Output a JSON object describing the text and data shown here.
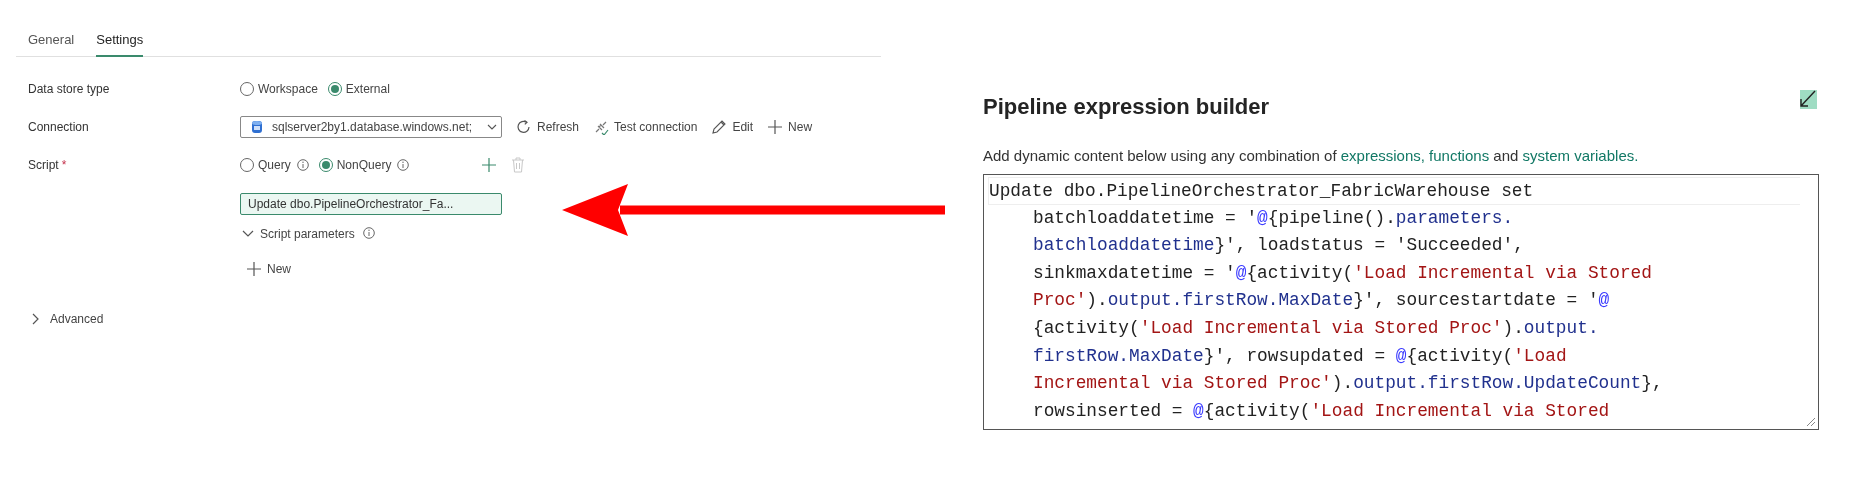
{
  "tabs": [
    {
      "label": "General",
      "selected": false
    },
    {
      "label": "Settings",
      "selected": true
    }
  ],
  "form": {
    "data_store_type": {
      "label": "Data store type",
      "options": [
        {
          "label": "Workspace",
          "selected": false
        },
        {
          "label": "External",
          "selected": true
        }
      ]
    },
    "connection": {
      "label": "Connection",
      "value": "sqlserver2by1.database.windows.net;",
      "actions": [
        {
          "label": "Refresh",
          "kind": "refresh"
        },
        {
          "label": "Test connection",
          "kind": "test"
        },
        {
          "label": "Edit",
          "kind": "edit"
        },
        {
          "label": "New",
          "kind": "new"
        }
      ]
    },
    "script": {
      "label": "Script",
      "required_mark": "*",
      "options": [
        {
          "label": "Query",
          "selected": false
        },
        {
          "label": "NonQuery",
          "selected": true
        }
      ],
      "delete_disabled": true,
      "value": "Update dbo.PipelineOrchestrator_Fa...",
      "parameters": {
        "label": "Script parameters",
        "expanded": true,
        "new_label": "New"
      }
    },
    "advanced": {
      "label": "Advanced",
      "expanded": false
    }
  },
  "expression_builder": {
    "title": "Pipeline expression builder",
    "description": [
      {
        "kind": "text",
        "text": "Add dynamic content below using any combination of "
      },
      {
        "kind": "link",
        "text": "expressions, functions"
      },
      {
        "kind": "text",
        "text": " and "
      },
      {
        "kind": "link",
        "text": "system variables."
      }
    ],
    "code_lines": [
      {
        "wrapped": false,
        "tokens": [
          {
            "kind": "text",
            "text": "Update dbo.PipelineOrchestrator_FabricWarehouse set"
          }
        ]
      },
      {
        "wrapped": true,
        "tokens": [
          {
            "kind": "text",
            "text": "batchloaddatetime = '"
          },
          {
            "kind": "at",
            "text": "@"
          },
          {
            "kind": "text",
            "text": "{pipeline()."
          },
          {
            "kind": "ident",
            "text": "parameters."
          }
        ]
      },
      {
        "wrapped": true,
        "tokens": [
          {
            "kind": "ident",
            "text": "batchloaddatetime"
          },
          {
            "kind": "text",
            "text": "}', loadstatus = 'Succeeded',"
          }
        ]
      },
      {
        "wrapped": true,
        "tokens": [
          {
            "kind": "text",
            "text": "sinkmaxdatetime = '"
          },
          {
            "kind": "at",
            "text": "@"
          },
          {
            "kind": "text",
            "text": "{activity("
          },
          {
            "kind": "string",
            "text": "'Load Incremental via Stored"
          }
        ]
      },
      {
        "wrapped": true,
        "tokens": [
          {
            "kind": "string",
            "text": "Proc'"
          },
          {
            "kind": "text",
            "text": ")."
          },
          {
            "kind": "ident",
            "text": "output.firstRow.MaxDate"
          },
          {
            "kind": "text",
            "text": "}', sourcestartdate = '"
          },
          {
            "kind": "at",
            "text": "@"
          }
        ]
      },
      {
        "wrapped": true,
        "tokens": [
          {
            "kind": "text",
            "text": "{activity("
          },
          {
            "kind": "string",
            "text": "'Load Incremental via Stored Proc'"
          },
          {
            "kind": "text",
            "text": ")."
          },
          {
            "kind": "ident",
            "text": "output."
          }
        ]
      },
      {
        "wrapped": true,
        "tokens": [
          {
            "kind": "ident",
            "text": "firstRow.MaxDate"
          },
          {
            "kind": "text",
            "text": "}', rowsupdated = "
          },
          {
            "kind": "at",
            "text": "@"
          },
          {
            "kind": "text",
            "text": "{activity("
          },
          {
            "kind": "string",
            "text": "'Load"
          }
        ]
      },
      {
        "wrapped": true,
        "tokens": [
          {
            "kind": "string",
            "text": "Incremental via Stored Proc'"
          },
          {
            "kind": "text",
            "text": ")."
          },
          {
            "kind": "ident",
            "text": "output.firstRow.UpdateCount"
          },
          {
            "kind": "text",
            "text": "},"
          }
        ]
      },
      {
        "wrapped": true,
        "tokens": [
          {
            "kind": "text",
            "text": "rowsinserted = "
          },
          {
            "kind": "at",
            "text": "@"
          },
          {
            "kind": "text",
            "text": "{activity("
          },
          {
            "kind": "string",
            "text": "'Load Incremental via Stored"
          }
        ]
      }
    ]
  }
}
